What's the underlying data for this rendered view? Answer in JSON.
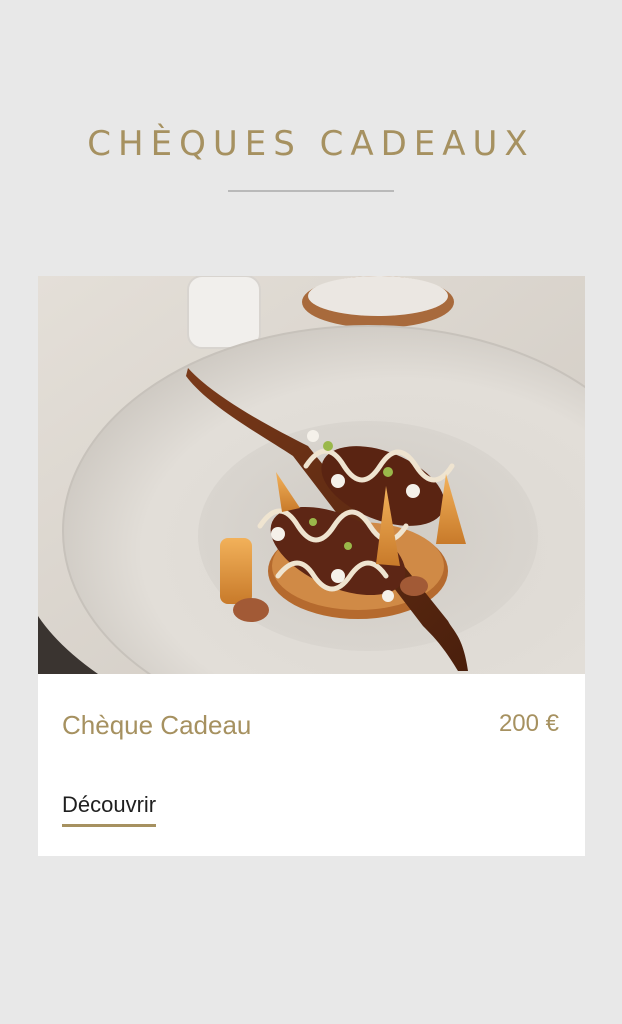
{
  "header": {
    "title": "CHÈQUES CADEAUX"
  },
  "card": {
    "image_alt": "plated dessert",
    "name": "Chèque Cadeau",
    "price": "200 €",
    "cta_label": "Découvrir"
  },
  "colors": {
    "accent": "#a69160",
    "background": "#e8e8e8",
    "card": "#ffffff",
    "text": "#1f1f1f",
    "rule": "#b9b9b9"
  }
}
